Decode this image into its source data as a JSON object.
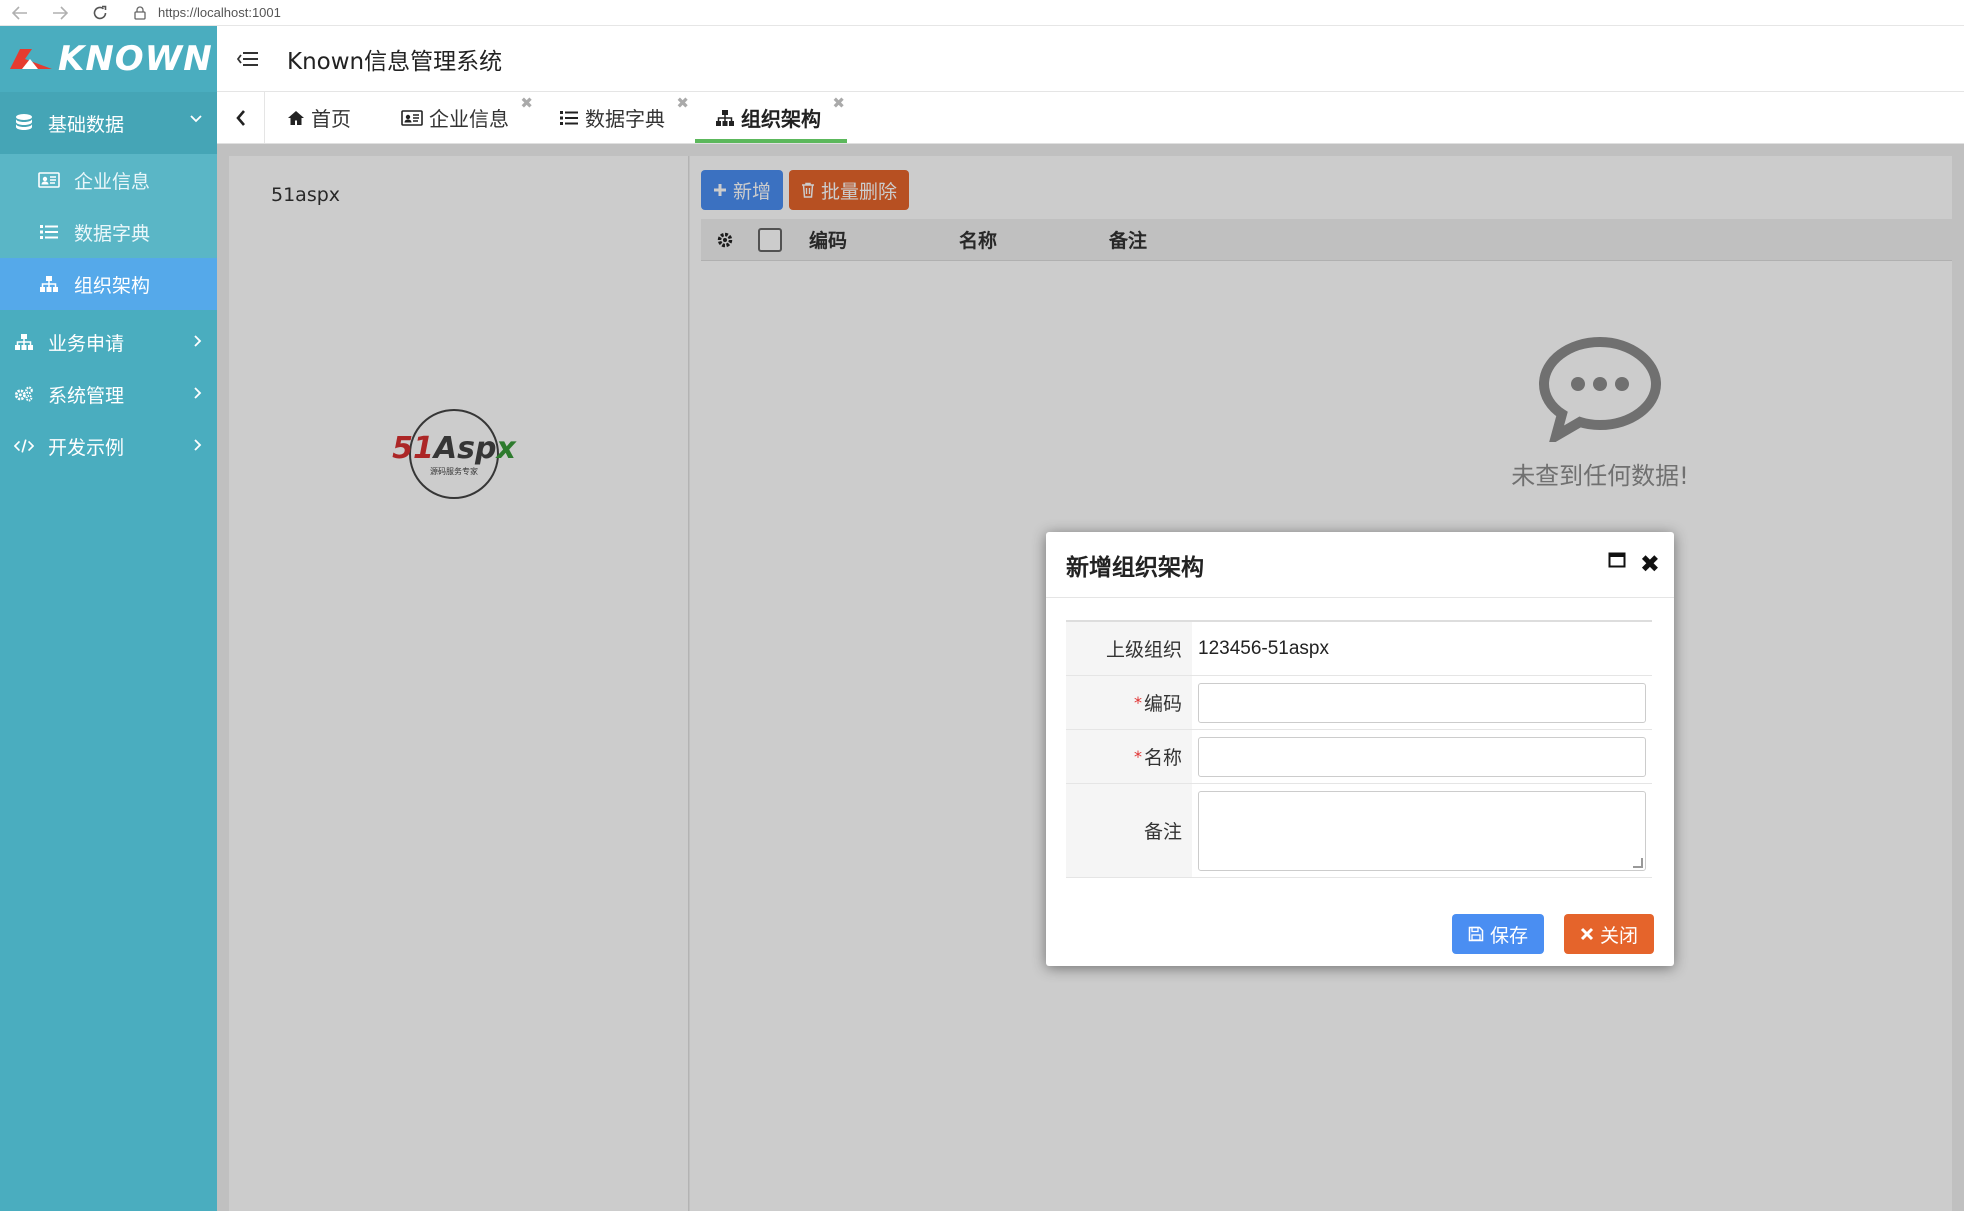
{
  "browser": {
    "url": "https://localhost:1001"
  },
  "sidebar": {
    "logo_text": "KNOWN",
    "groups": [
      {
        "label": "基础数据",
        "items": [
          {
            "label": "企业信息",
            "icon": "id-card-icon"
          },
          {
            "label": "数据字典",
            "icon": "list-icon"
          },
          {
            "label": "组织架构",
            "icon": "sitemap-icon",
            "active": true
          }
        ]
      },
      {
        "label": "业务申请",
        "icon": "sitemap-icon"
      },
      {
        "label": "系统管理",
        "icon": "gears-icon"
      },
      {
        "label": "开发示例",
        "icon": "code-icon"
      }
    ]
  },
  "header": {
    "title": "Known信息管理系统"
  },
  "tabs": [
    {
      "label": "首页",
      "icon": "home-icon"
    },
    {
      "label": "企业信息",
      "icon": "id-card-icon"
    },
    {
      "label": "数据字典",
      "icon": "list-icon"
    },
    {
      "label": "组织架构",
      "icon": "sitemap-icon",
      "active": true
    }
  ],
  "tree": {
    "root": "51aspx"
  },
  "brand_logo": {
    "text": "51Aspx",
    "sub": "源码服务专家"
  },
  "toolbar": {
    "add_label": "新增",
    "batch_delete_label": "批量删除"
  },
  "table": {
    "columns": [
      "编码",
      "名称",
      "备注"
    ],
    "empty_text": "未查到任何数据!"
  },
  "dialog": {
    "title": "新增组织架构",
    "fields": [
      {
        "label": "上级组织",
        "value": "123456-51aspx",
        "required": false
      },
      {
        "label": "编码",
        "value": "",
        "required": true
      },
      {
        "label": "名称",
        "value": "",
        "required": true
      },
      {
        "label": "备注",
        "value": "",
        "required": false
      }
    ],
    "required_mark": "*",
    "save_label": "保存",
    "close_label": "关闭"
  },
  "colors": {
    "sidebar_bg": "#4aadbf",
    "active_menu": "#55a9ea",
    "primary_btn": "#4a8ef2",
    "danger_btn": "#e5642b",
    "active_tab_underline": "#5cb85c"
  }
}
